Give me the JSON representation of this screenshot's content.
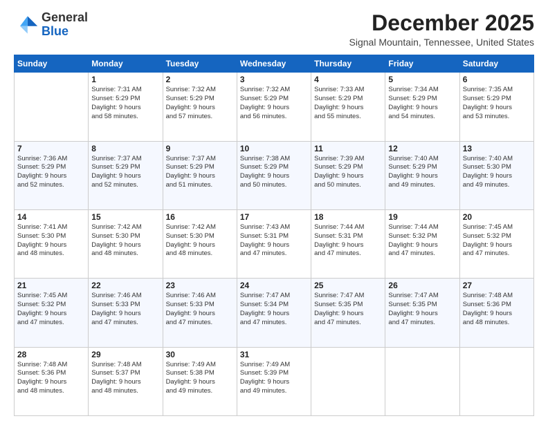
{
  "header": {
    "logo": {
      "general": "General",
      "blue": "Blue"
    },
    "month": "December 2025",
    "location": "Signal Mountain, Tennessee, United States"
  },
  "days_of_week": [
    "Sunday",
    "Monday",
    "Tuesday",
    "Wednesday",
    "Thursday",
    "Friday",
    "Saturday"
  ],
  "weeks": [
    [
      {
        "day": "",
        "info": ""
      },
      {
        "day": "1",
        "info": "Sunrise: 7:31 AM\nSunset: 5:29 PM\nDaylight: 9 hours\nand 58 minutes."
      },
      {
        "day": "2",
        "info": "Sunrise: 7:32 AM\nSunset: 5:29 PM\nDaylight: 9 hours\nand 57 minutes."
      },
      {
        "day": "3",
        "info": "Sunrise: 7:32 AM\nSunset: 5:29 PM\nDaylight: 9 hours\nand 56 minutes."
      },
      {
        "day": "4",
        "info": "Sunrise: 7:33 AM\nSunset: 5:29 PM\nDaylight: 9 hours\nand 55 minutes."
      },
      {
        "day": "5",
        "info": "Sunrise: 7:34 AM\nSunset: 5:29 PM\nDaylight: 9 hours\nand 54 minutes."
      },
      {
        "day": "6",
        "info": "Sunrise: 7:35 AM\nSunset: 5:29 PM\nDaylight: 9 hours\nand 53 minutes."
      }
    ],
    [
      {
        "day": "7",
        "info": "Sunrise: 7:36 AM\nSunset: 5:29 PM\nDaylight: 9 hours\nand 52 minutes."
      },
      {
        "day": "8",
        "info": "Sunrise: 7:37 AM\nSunset: 5:29 PM\nDaylight: 9 hours\nand 52 minutes."
      },
      {
        "day": "9",
        "info": "Sunrise: 7:37 AM\nSunset: 5:29 PM\nDaylight: 9 hours\nand 51 minutes."
      },
      {
        "day": "10",
        "info": "Sunrise: 7:38 AM\nSunset: 5:29 PM\nDaylight: 9 hours\nand 50 minutes."
      },
      {
        "day": "11",
        "info": "Sunrise: 7:39 AM\nSunset: 5:29 PM\nDaylight: 9 hours\nand 50 minutes."
      },
      {
        "day": "12",
        "info": "Sunrise: 7:40 AM\nSunset: 5:29 PM\nDaylight: 9 hours\nand 49 minutes."
      },
      {
        "day": "13",
        "info": "Sunrise: 7:40 AM\nSunset: 5:30 PM\nDaylight: 9 hours\nand 49 minutes."
      }
    ],
    [
      {
        "day": "14",
        "info": "Sunrise: 7:41 AM\nSunset: 5:30 PM\nDaylight: 9 hours\nand 48 minutes."
      },
      {
        "day": "15",
        "info": "Sunrise: 7:42 AM\nSunset: 5:30 PM\nDaylight: 9 hours\nand 48 minutes."
      },
      {
        "day": "16",
        "info": "Sunrise: 7:42 AM\nSunset: 5:30 PM\nDaylight: 9 hours\nand 48 minutes."
      },
      {
        "day": "17",
        "info": "Sunrise: 7:43 AM\nSunset: 5:31 PM\nDaylight: 9 hours\nand 47 minutes."
      },
      {
        "day": "18",
        "info": "Sunrise: 7:44 AM\nSunset: 5:31 PM\nDaylight: 9 hours\nand 47 minutes."
      },
      {
        "day": "19",
        "info": "Sunrise: 7:44 AM\nSunset: 5:32 PM\nDaylight: 9 hours\nand 47 minutes."
      },
      {
        "day": "20",
        "info": "Sunrise: 7:45 AM\nSunset: 5:32 PM\nDaylight: 9 hours\nand 47 minutes."
      }
    ],
    [
      {
        "day": "21",
        "info": "Sunrise: 7:45 AM\nSunset: 5:32 PM\nDaylight: 9 hours\nand 47 minutes."
      },
      {
        "day": "22",
        "info": "Sunrise: 7:46 AM\nSunset: 5:33 PM\nDaylight: 9 hours\nand 47 minutes."
      },
      {
        "day": "23",
        "info": "Sunrise: 7:46 AM\nSunset: 5:33 PM\nDaylight: 9 hours\nand 47 minutes."
      },
      {
        "day": "24",
        "info": "Sunrise: 7:47 AM\nSunset: 5:34 PM\nDaylight: 9 hours\nand 47 minutes."
      },
      {
        "day": "25",
        "info": "Sunrise: 7:47 AM\nSunset: 5:35 PM\nDaylight: 9 hours\nand 47 minutes."
      },
      {
        "day": "26",
        "info": "Sunrise: 7:47 AM\nSunset: 5:35 PM\nDaylight: 9 hours\nand 47 minutes."
      },
      {
        "day": "27",
        "info": "Sunrise: 7:48 AM\nSunset: 5:36 PM\nDaylight: 9 hours\nand 48 minutes."
      }
    ],
    [
      {
        "day": "28",
        "info": "Sunrise: 7:48 AM\nSunset: 5:36 PM\nDaylight: 9 hours\nand 48 minutes."
      },
      {
        "day": "29",
        "info": "Sunrise: 7:48 AM\nSunset: 5:37 PM\nDaylight: 9 hours\nand 48 minutes."
      },
      {
        "day": "30",
        "info": "Sunrise: 7:49 AM\nSunset: 5:38 PM\nDaylight: 9 hours\nand 49 minutes."
      },
      {
        "day": "31",
        "info": "Sunrise: 7:49 AM\nSunset: 5:39 PM\nDaylight: 9 hours\nand 49 minutes."
      },
      {
        "day": "",
        "info": ""
      },
      {
        "day": "",
        "info": ""
      },
      {
        "day": "",
        "info": ""
      }
    ]
  ]
}
